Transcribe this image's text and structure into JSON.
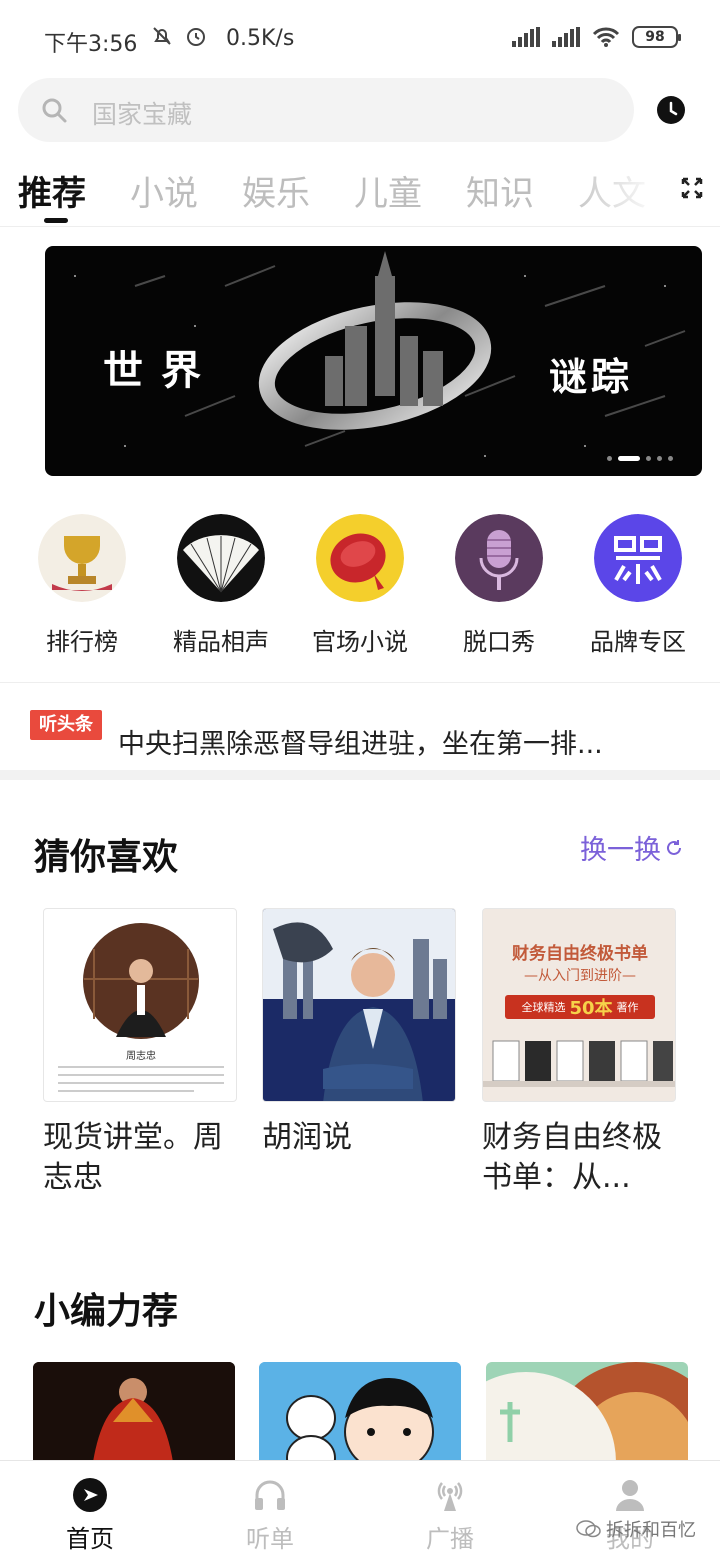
{
  "status": {
    "time": "下午3:56",
    "speed": "0.5K/s",
    "battery": "98"
  },
  "search": {
    "placeholder": "国家宝藏"
  },
  "tabs": [
    "推荐",
    "小说",
    "娱乐",
    "儿童",
    "知识",
    "人文"
  ],
  "banner": {
    "left_text": "世界",
    "right_text": "谜踪"
  },
  "categories": [
    {
      "label": "排行榜",
      "icon": "trophy-icon"
    },
    {
      "label": "精品相声",
      "icon": "fan-icon"
    },
    {
      "label": "官场小说",
      "icon": "seal-icon"
    },
    {
      "label": "脱口秀",
      "icon": "microphone-icon"
    },
    {
      "label": "品牌专区",
      "icon": "brand-icon"
    }
  ],
  "headline": {
    "badge": "听头条",
    "text": "中央扫黑除恶督导组进驻，坐在第一排..."
  },
  "guess": {
    "title": "猜你喜欢",
    "refresh": "换一换",
    "items": [
      {
        "title": "现货讲堂。周志忠",
        "cover_caption": "周志忠"
      },
      {
        "title": "胡润说"
      },
      {
        "title": "财务自由终极书单：从...",
        "cover_title": "财务自由终极书单",
        "cover_sub": "—从入门到进阶—",
        "cover_tag": "全球精选",
        "cover_count": "50本",
        "cover_tag2": "著作"
      }
    ]
  },
  "picks": {
    "title": "小编力荐"
  },
  "nav": [
    {
      "label": "首页",
      "icon": "compass-icon"
    },
    {
      "label": "听单",
      "icon": "headphones-icon"
    },
    {
      "label": "广播",
      "icon": "broadcast-icon"
    },
    {
      "label": "我的",
      "icon": "person-icon"
    }
  ],
  "watermark": "拆拆和百忆",
  "colors": {
    "accent": "#7b61d9",
    "badge": "#e94a3d"
  }
}
